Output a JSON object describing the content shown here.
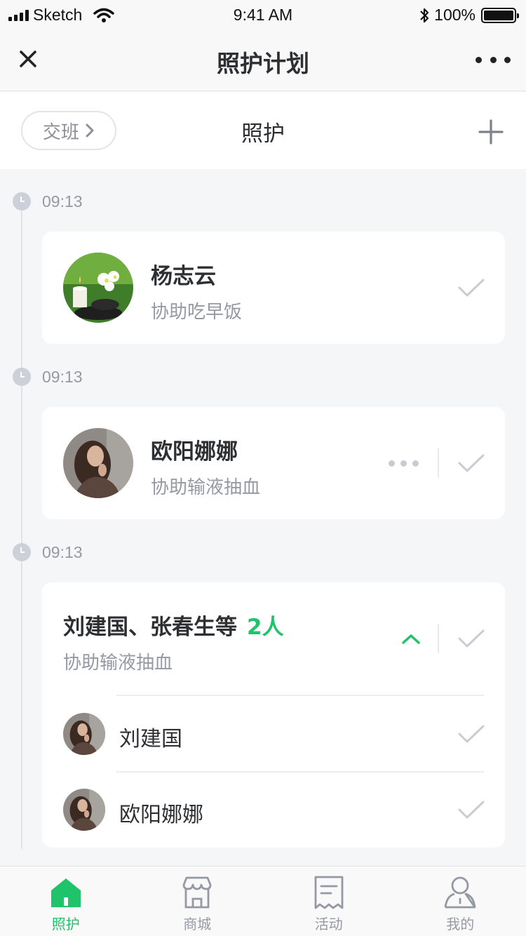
{
  "status_bar": {
    "carrier": "Sketch",
    "time": "9:41 AM",
    "battery": "100%"
  },
  "nav": {
    "title": "照护计划"
  },
  "sub_header": {
    "handover_label": "交班",
    "title": "照护"
  },
  "timeline": [
    {
      "time": "09:13",
      "name": "杨志云",
      "task": "协助吃早饭",
      "avatar": "orchid-spa-photo"
    },
    {
      "time": "09:13",
      "name": "欧阳娜娜",
      "task": "协助输液抽血",
      "avatar": "woman-portrait-photo"
    },
    {
      "time": "09:13",
      "name": "刘建国、张春生等",
      "count": "2人",
      "task": "协助输液抽血",
      "members": [
        {
          "name": "刘建国",
          "avatar": "woman-portrait-photo"
        },
        {
          "name": "欧阳娜娜",
          "avatar": "woman-portrait-photo"
        }
      ]
    }
  ],
  "tabs": [
    {
      "label": "照护",
      "icon": "home-icon",
      "active": true
    },
    {
      "label": "商城",
      "icon": "store-icon",
      "active": false
    },
    {
      "label": "活动",
      "icon": "receipt-icon",
      "active": false
    },
    {
      "label": "我的",
      "icon": "user-icon",
      "active": false
    }
  ],
  "colors": {
    "accent": "#1fc46a",
    "check": "#c9ccd4",
    "background": "#f5f6f8"
  }
}
